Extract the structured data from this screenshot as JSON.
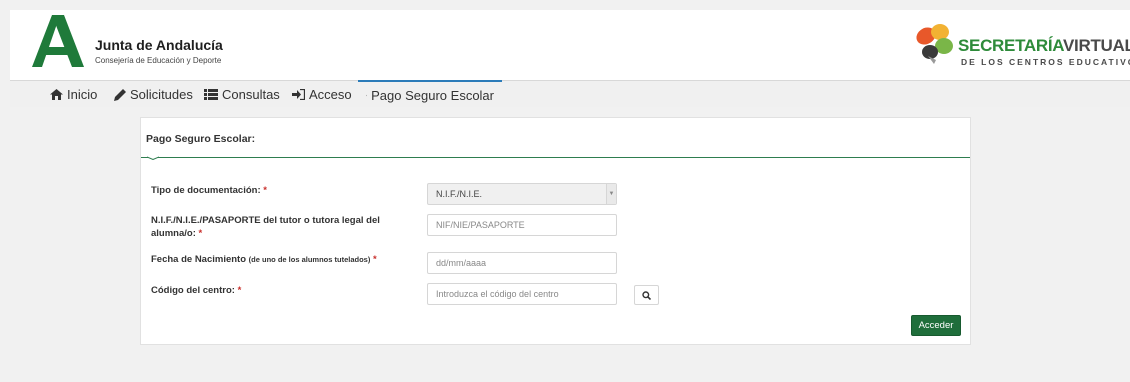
{
  "header": {
    "brand_title": "Junta de Andalucía",
    "brand_subtitle": "Consejería de Educación y Deporte",
    "sv_title_part1": "SECRETARÍA",
    "sv_title_part2": "VIRTUAL",
    "sv_subtitle": "DE LOS CENTROS EDUCATIVOS",
    "brand_color": "#1f7a3a"
  },
  "nav": {
    "items": [
      {
        "label": "Inicio",
        "icon": "home-icon"
      },
      {
        "label": "Solicitudes",
        "icon": "pencil-icon"
      },
      {
        "label": "Consultas",
        "icon": "list-icon"
      },
      {
        "label": "Acceso",
        "icon": "sign-in-icon"
      },
      {
        "label": "Pago Seguro Escolar",
        "icon": "credit-card-icon",
        "active": true
      }
    ]
  },
  "form": {
    "title": "Pago Seguro Escolar:",
    "required_mark": "*",
    "doc_type_label": "Tipo de documentación:",
    "doc_type_value": "N.I.F./N.I.E.",
    "nif_label": "N.I.F./N.I.E./PASAPORTE del tutor o tutora legal del alumna/o:",
    "nif_placeholder": "NIF/NIE/PASAPORTE",
    "birth_label": "Fecha de Nacimiento",
    "birth_note": "(de uno de los alumnos tutelados)",
    "birth_placeholder": "dd/mm/aaaa",
    "centre_label": "Código del centro:",
    "centre_placeholder": "Introduzca el código del centro",
    "submit_label": "Acceder",
    "accent_color": "#2e7d4f",
    "button_color": "#1f6e3b",
    "required_color": "#c9302c"
  }
}
